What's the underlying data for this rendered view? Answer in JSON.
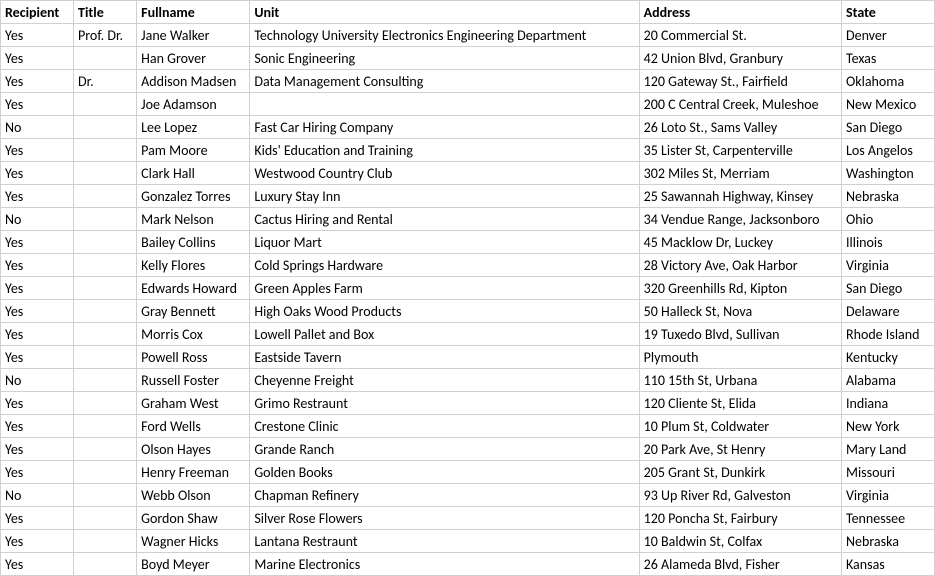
{
  "headers": [
    "Recipient",
    "Title",
    "Fullname",
    "Unit",
    "Address",
    "State"
  ],
  "rows": [
    {
      "recipient": "Yes",
      "title": "Prof. Dr.",
      "fullname": "Jane Walker",
      "unit": "Technology University Electronics Engineering Department",
      "address": "20 Commercial St.",
      "state": "Denver"
    },
    {
      "recipient": "Yes",
      "title": "",
      "fullname": "Han Grover",
      "unit": "Sonic Engineering",
      "address": "42 Union Blvd, Granbury",
      "state": "Texas"
    },
    {
      "recipient": "Yes",
      "title": "Dr.",
      "fullname": "Addison Madsen",
      "unit": "Data Management Consulting",
      "address": "120 Gateway St., Fairfield",
      "state": "Oklahoma"
    },
    {
      "recipient": "Yes",
      "title": "",
      "fullname": "Joe Adamson",
      "unit": "",
      "address": "200 C Central Creek, Muleshoe",
      "state": "New Mexico"
    },
    {
      "recipient": "No",
      "title": "",
      "fullname": "Lee Lopez",
      "unit": "Fast Car Hiring Company",
      "address": "26 Loto St., Sams Valley",
      "state": "San Diego"
    },
    {
      "recipient": "Yes",
      "title": "",
      "fullname": "Pam Moore",
      "unit": "Kids' Education and Training",
      "address": "35 Lister St, Carpenterville",
      "state": "Los Angelos"
    },
    {
      "recipient": "Yes",
      "title": "",
      "fullname": "Clark Hall",
      "unit": "Westwood Country Club",
      "address": "302 Miles St, Merriam",
      "state": "Washington"
    },
    {
      "recipient": "Yes",
      "title": "",
      "fullname": "Gonzalez Torres",
      "unit": "Luxury Stay Inn",
      "address": "25 Sawannah Highway, Kinsey",
      "state": "Nebraska"
    },
    {
      "recipient": "No",
      "title": "",
      "fullname": "Mark Nelson",
      "unit": "Cactus Hiring and Rental",
      "address": "34 Vendue Range, Jacksonboro",
      "state": "Ohio"
    },
    {
      "recipient": "Yes",
      "title": "",
      "fullname": "Bailey Collins",
      "unit": "Liquor Mart",
      "address": "45 Macklow Dr, Luckey",
      "state": "Illinois"
    },
    {
      "recipient": "Yes",
      "title": "",
      "fullname": "Kelly Flores",
      "unit": "Cold Springs Hardware",
      "address": "28 Victory Ave, Oak Harbor",
      "state": "Virginia"
    },
    {
      "recipient": "Yes",
      "title": "",
      "fullname": "Edwards Howard",
      "unit": "Green Apples Farm",
      "address": "320 Greenhills Rd, Kipton",
      "state": "San Diego"
    },
    {
      "recipient": "Yes",
      "title": "",
      "fullname": "Gray Bennett",
      "unit": "High Oaks Wood Products",
      "address": "50 Halleck St, Nova",
      "state": "Delaware"
    },
    {
      "recipient": "Yes",
      "title": "",
      "fullname": "Morris Cox",
      "unit": "Lowell Pallet and Box",
      "address": "19 Tuxedo Blvd, Sullivan",
      "state": "Rhode Island"
    },
    {
      "recipient": "Yes",
      "title": "",
      "fullname": "Powell Ross",
      "unit": "Eastside Tavern",
      "address": "Plymouth",
      "state": "Kentucky"
    },
    {
      "recipient": "No",
      "title": "",
      "fullname": "Russell Foster",
      "unit": "Cheyenne Freight",
      "address": "110 15th St, Urbana",
      "state": "Alabama"
    },
    {
      "recipient": "Yes",
      "title": "",
      "fullname": "Graham West",
      "unit": "Grimo Restraunt",
      "address": "120 Cliente St, Elida",
      "state": "Indiana"
    },
    {
      "recipient": "Yes",
      "title": "",
      "fullname": "Ford Wells",
      "unit": "Crestone Clinic",
      "address": "10 Plum St, Coldwater",
      "state": "New York"
    },
    {
      "recipient": "Yes",
      "title": "",
      "fullname": "Olson Hayes",
      "unit": "Grande Ranch",
      "address": "20 Park Ave, St Henry",
      "state": "Mary Land"
    },
    {
      "recipient": "Yes",
      "title": "",
      "fullname": "Henry Freeman",
      "unit": "Golden Books",
      "address": "205 Grant St, Dunkirk",
      "state": "Missouri"
    },
    {
      "recipient": "No",
      "title": "",
      "fullname": "Webb Olson",
      "unit": "Chapman Refinery",
      "address": "93 Up River Rd, Galveston",
      "state": "Virginia"
    },
    {
      "recipient": "Yes",
      "title": "",
      "fullname": "Gordon Shaw",
      "unit": "Silver Rose Flowers",
      "address": "120 Poncha St, Fairbury",
      "state": "Tennessee"
    },
    {
      "recipient": "Yes",
      "title": "",
      "fullname": "Wagner Hicks",
      "unit": "Lantana Restraunt",
      "address": "10 Baldwin St, Colfax",
      "state": "Nebraska"
    },
    {
      "recipient": "Yes",
      "title": "",
      "fullname": "Boyd Meyer",
      "unit": "Marine Electronics",
      "address": "26 Alameda Blvd, Fisher",
      "state": "Kansas"
    }
  ]
}
